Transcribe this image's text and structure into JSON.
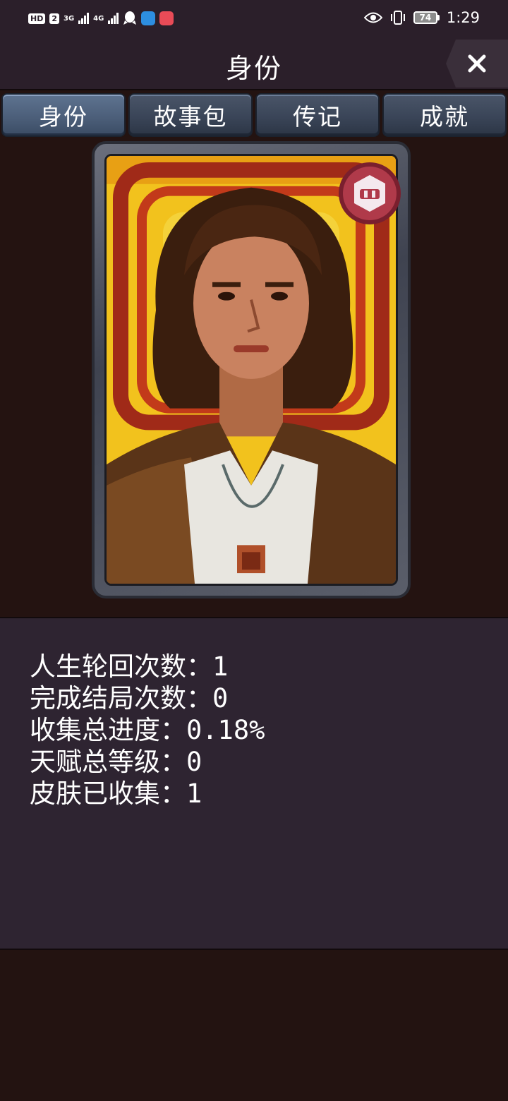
{
  "status_bar": {
    "network_label": "HD",
    "sim_label": "2",
    "signal1_label": "3G",
    "signal2_label": "4G",
    "battery": "74",
    "time": "1:29"
  },
  "header": {
    "title": "身份",
    "close_icon": "close-icon"
  },
  "tabs": [
    {
      "label": "身份",
      "active": true
    },
    {
      "label": "故事包",
      "active": false
    },
    {
      "label": "传记",
      "active": false
    },
    {
      "label": "成就",
      "active": false
    }
  ],
  "portrait": {
    "badge_icon": "skin-badge-icon",
    "subject": "character-portrait"
  },
  "stats": [
    "人生轮回次数：1",
    "完成结局次数：0",
    "收集总进度：0.18%",
    "天赋总等级：0",
    "皮肤已收集：1"
  ],
  "colors": {
    "background": "#231311",
    "panel": "#2e2431",
    "tab": "#3a4558",
    "tab_active": "#4c5f7a",
    "badge": "#b03a4a"
  }
}
